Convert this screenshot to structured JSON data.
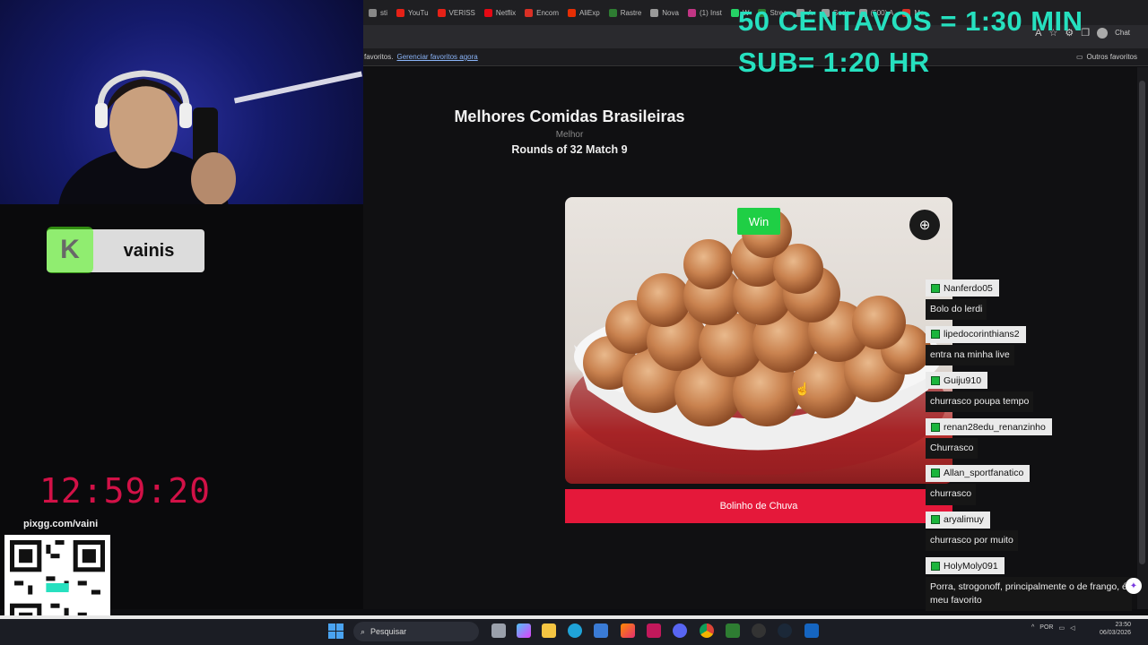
{
  "browser": {
    "tabs": [
      {
        "label": "sti",
        "color": "#888888"
      },
      {
        "label": "YouTu",
        "color": "#e62117"
      },
      {
        "label": "VERISS",
        "color": "#e62117"
      },
      {
        "label": "Netflix",
        "color": "#e50914"
      },
      {
        "label": "Encom",
        "color": "#d93025"
      },
      {
        "label": "AliExp",
        "color": "#e62e04"
      },
      {
        "label": "Rastre",
        "color": "#2e7d32"
      },
      {
        "label": "Nova",
        "color": "#999999"
      },
      {
        "label": "(1) Inst",
        "color": "#c13584"
      },
      {
        "label": "W",
        "color": "#25d366"
      },
      {
        "label": "Strea",
        "color": "#2e7d32"
      },
      {
        "label": "A",
        "color": "#999999"
      },
      {
        "label": "Seda",
        "color": "#999999"
      },
      {
        "label": "(500) A",
        "color": "#999999"
      },
      {
        "label": "Me",
        "color": "#d93025"
      }
    ],
    "bookmarks_prefix": "favoritos.",
    "bookmarks_link": "Gerenciar favoritos agora",
    "other_favorites": "Outros favoritos",
    "chat_label": "Chat"
  },
  "page": {
    "title": "Melhores Comidas Brasileiras",
    "subtitle": "Melhor",
    "round": "Rounds of 32 Match 9",
    "win_label": "Win",
    "item_name": "Bolinho de Chuva"
  },
  "overlay": {
    "kick_letter": "K",
    "kick_username": "vainis",
    "timer": "12:59:20",
    "pix_label": "pixgg.com/vaini",
    "promo_line1": "50 CENTAVOS = 1:30 MIN",
    "promo_line2": "SUB= 1:20 HR"
  },
  "chat": [
    {
      "user": "Nanferdo05",
      "text": "Bolo do lerdi"
    },
    {
      "user": "lipedocorinthians2",
      "text": "entra na minha live"
    },
    {
      "user": "Guiju910",
      "text": "churrasco poupa tempo"
    },
    {
      "user": "renan28edu_renanzinho",
      "text": "Churrasco"
    },
    {
      "user": "Allan_sportfanatico",
      "text": "churrasco"
    },
    {
      "user": "aryalimuy",
      "text": "churrasco por muito"
    },
    {
      "user": "HolyMoly091",
      "text": "Porra, strogonoff, principalmente o de frango, é meu favorito"
    }
  ],
  "taskbar": {
    "search_placeholder": "Pesquisar",
    "lang": "POR",
    "time": "23:50",
    "date": "06/03/2026"
  },
  "colors": {
    "win_green": "#1fcf45",
    "name_bar_red": "#e5183a",
    "timer_red": "#d21147",
    "promo_teal": "#26e0bf"
  }
}
